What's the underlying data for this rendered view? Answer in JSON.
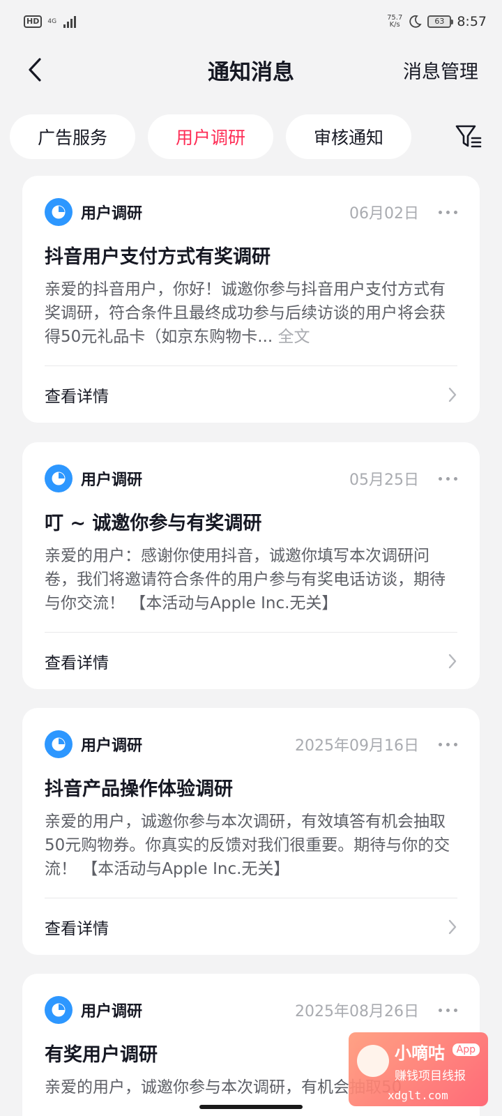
{
  "status_bar": {
    "hd": "HD",
    "network": "4G",
    "speed_value": "75.7",
    "speed_unit": "K/s",
    "battery": "63",
    "time": "8:57"
  },
  "header": {
    "title": "通知消息",
    "manage": "消息管理"
  },
  "tabs": [
    {
      "label": "广告服务",
      "active": false
    },
    {
      "label": "用户调研",
      "active": true
    },
    {
      "label": "审核通知",
      "active": false
    }
  ],
  "icons": {
    "back": "chevron-left-icon",
    "filter": "filter-icon",
    "more": "more-dots-icon",
    "chevron": "chevron-right-icon",
    "source": "pie-chart-icon"
  },
  "colors": {
    "accent": "#fe2c55",
    "source_icon": "#2d97ff"
  },
  "cards": [
    {
      "source": "用户调研",
      "date": "06月02日",
      "title": "抖音用户支付方式有奖调研",
      "body": "亲爱的抖音用户，你好！诚邀你参与抖音用户支付方式有奖调研，符合条件且最终成功参与后续访谈的用户将会获得50元礼品卡（如京东购物卡... ",
      "more": "全文",
      "action": "查看详情"
    },
    {
      "source": "用户调研",
      "date": "05月25日",
      "title": "叮 ~ 诚邀你参与有奖调研",
      "body": "亲爱的用户：感谢你使用抖音，诚邀你填写本次调研问卷，我们将邀请符合条件的用户参与有奖电话访谈，期待与你交流！ 【本活动与Apple Inc.无关】",
      "more": "",
      "action": "查看详情"
    },
    {
      "source": "用户调研",
      "date": "2025年09月16日",
      "title": "抖音产品操作体验调研",
      "body": "亲爱的用户，诚邀你参与本次调研，有效填答有机会抽取50元购物券。你真实的反馈对我们很重要。期待与你的交流！ 【本活动与Apple Inc.无关】",
      "more": "",
      "action": "查看详情"
    },
    {
      "source": "用户调研",
      "date": "2025年08月26日",
      "title": "有奖用户调研",
      "body": "亲爱的用户，诚邀你参与本次调研，有机会抽取50",
      "more": "",
      "action": ""
    }
  ],
  "watermark": {
    "name": "小嘀咕",
    "app": "App",
    "slogan": "赚钱项目线报",
    "url": "xdglt.com"
  }
}
